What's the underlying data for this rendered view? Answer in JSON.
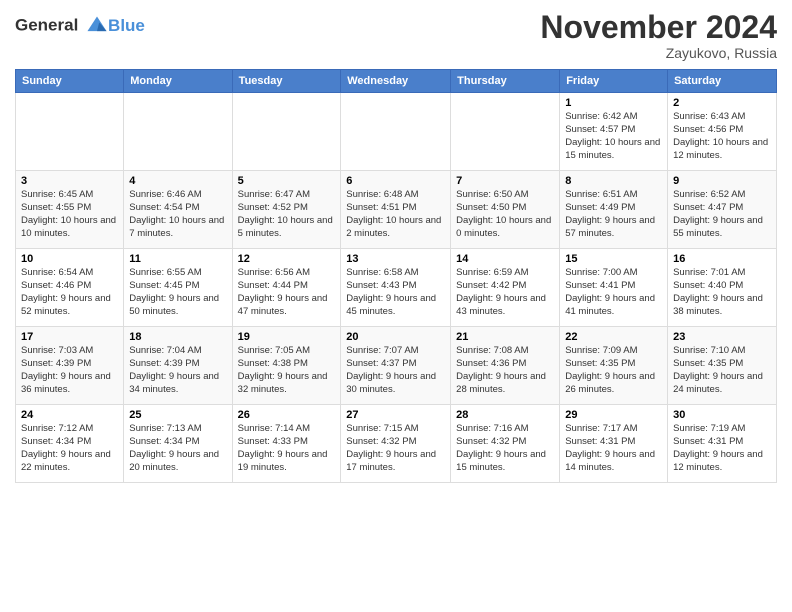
{
  "header": {
    "logo_line1": "General",
    "logo_line2": "Blue",
    "month_title": "November 2024",
    "location": "Zayukovo, Russia"
  },
  "days_of_week": [
    "Sunday",
    "Monday",
    "Tuesday",
    "Wednesday",
    "Thursday",
    "Friday",
    "Saturday"
  ],
  "weeks": [
    [
      {
        "day": "",
        "info": ""
      },
      {
        "day": "",
        "info": ""
      },
      {
        "day": "",
        "info": ""
      },
      {
        "day": "",
        "info": ""
      },
      {
        "day": "",
        "info": ""
      },
      {
        "day": "1",
        "info": "Sunrise: 6:42 AM\nSunset: 4:57 PM\nDaylight: 10 hours and 15 minutes."
      },
      {
        "day": "2",
        "info": "Sunrise: 6:43 AM\nSunset: 4:56 PM\nDaylight: 10 hours and 12 minutes."
      }
    ],
    [
      {
        "day": "3",
        "info": "Sunrise: 6:45 AM\nSunset: 4:55 PM\nDaylight: 10 hours and 10 minutes."
      },
      {
        "day": "4",
        "info": "Sunrise: 6:46 AM\nSunset: 4:54 PM\nDaylight: 10 hours and 7 minutes."
      },
      {
        "day": "5",
        "info": "Sunrise: 6:47 AM\nSunset: 4:52 PM\nDaylight: 10 hours and 5 minutes."
      },
      {
        "day": "6",
        "info": "Sunrise: 6:48 AM\nSunset: 4:51 PM\nDaylight: 10 hours and 2 minutes."
      },
      {
        "day": "7",
        "info": "Sunrise: 6:50 AM\nSunset: 4:50 PM\nDaylight: 10 hours and 0 minutes."
      },
      {
        "day": "8",
        "info": "Sunrise: 6:51 AM\nSunset: 4:49 PM\nDaylight: 9 hours and 57 minutes."
      },
      {
        "day": "9",
        "info": "Sunrise: 6:52 AM\nSunset: 4:47 PM\nDaylight: 9 hours and 55 minutes."
      }
    ],
    [
      {
        "day": "10",
        "info": "Sunrise: 6:54 AM\nSunset: 4:46 PM\nDaylight: 9 hours and 52 minutes."
      },
      {
        "day": "11",
        "info": "Sunrise: 6:55 AM\nSunset: 4:45 PM\nDaylight: 9 hours and 50 minutes."
      },
      {
        "day": "12",
        "info": "Sunrise: 6:56 AM\nSunset: 4:44 PM\nDaylight: 9 hours and 47 minutes."
      },
      {
        "day": "13",
        "info": "Sunrise: 6:58 AM\nSunset: 4:43 PM\nDaylight: 9 hours and 45 minutes."
      },
      {
        "day": "14",
        "info": "Sunrise: 6:59 AM\nSunset: 4:42 PM\nDaylight: 9 hours and 43 minutes."
      },
      {
        "day": "15",
        "info": "Sunrise: 7:00 AM\nSunset: 4:41 PM\nDaylight: 9 hours and 41 minutes."
      },
      {
        "day": "16",
        "info": "Sunrise: 7:01 AM\nSunset: 4:40 PM\nDaylight: 9 hours and 38 minutes."
      }
    ],
    [
      {
        "day": "17",
        "info": "Sunrise: 7:03 AM\nSunset: 4:39 PM\nDaylight: 9 hours and 36 minutes."
      },
      {
        "day": "18",
        "info": "Sunrise: 7:04 AM\nSunset: 4:39 PM\nDaylight: 9 hours and 34 minutes."
      },
      {
        "day": "19",
        "info": "Sunrise: 7:05 AM\nSunset: 4:38 PM\nDaylight: 9 hours and 32 minutes."
      },
      {
        "day": "20",
        "info": "Sunrise: 7:07 AM\nSunset: 4:37 PM\nDaylight: 9 hours and 30 minutes."
      },
      {
        "day": "21",
        "info": "Sunrise: 7:08 AM\nSunset: 4:36 PM\nDaylight: 9 hours and 28 minutes."
      },
      {
        "day": "22",
        "info": "Sunrise: 7:09 AM\nSunset: 4:35 PM\nDaylight: 9 hours and 26 minutes."
      },
      {
        "day": "23",
        "info": "Sunrise: 7:10 AM\nSunset: 4:35 PM\nDaylight: 9 hours and 24 minutes."
      }
    ],
    [
      {
        "day": "24",
        "info": "Sunrise: 7:12 AM\nSunset: 4:34 PM\nDaylight: 9 hours and 22 minutes."
      },
      {
        "day": "25",
        "info": "Sunrise: 7:13 AM\nSunset: 4:34 PM\nDaylight: 9 hours and 20 minutes."
      },
      {
        "day": "26",
        "info": "Sunrise: 7:14 AM\nSunset: 4:33 PM\nDaylight: 9 hours and 19 minutes."
      },
      {
        "day": "27",
        "info": "Sunrise: 7:15 AM\nSunset: 4:32 PM\nDaylight: 9 hours and 17 minutes."
      },
      {
        "day": "28",
        "info": "Sunrise: 7:16 AM\nSunset: 4:32 PM\nDaylight: 9 hours and 15 minutes."
      },
      {
        "day": "29",
        "info": "Sunrise: 7:17 AM\nSunset: 4:31 PM\nDaylight: 9 hours and 14 minutes."
      },
      {
        "day": "30",
        "info": "Sunrise: 7:19 AM\nSunset: 4:31 PM\nDaylight: 9 hours and 12 minutes."
      }
    ]
  ]
}
